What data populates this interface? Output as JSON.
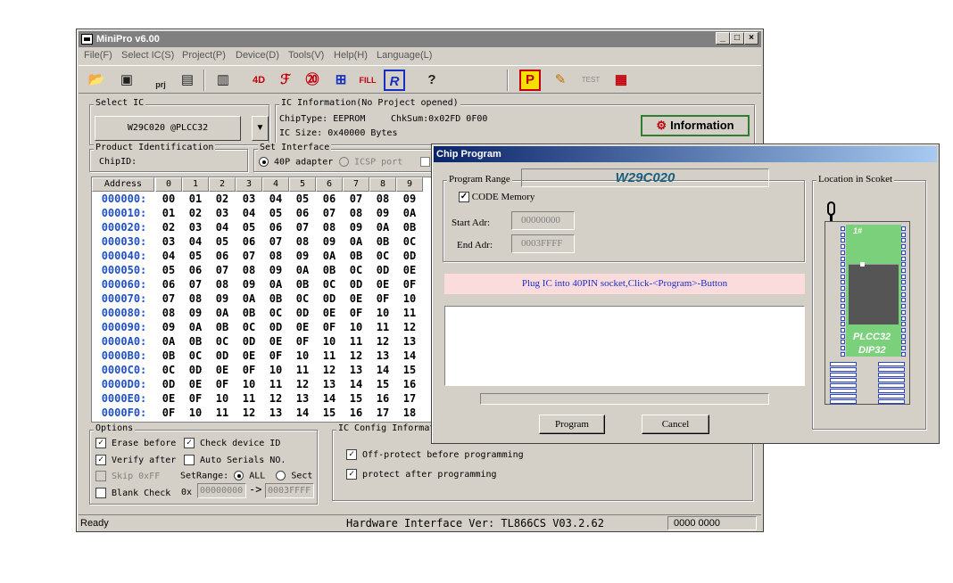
{
  "window": {
    "title": "MiniPro v6.00",
    "min": "_",
    "max": "□",
    "close": "×"
  },
  "menu": [
    "File(F)",
    "Select IC(S)",
    "Project(P)",
    "Device(D)",
    "Tools(V)",
    "Help(H)",
    "Language(L)"
  ],
  "toolbar": {
    "prj_label": "prj",
    "open": "📂",
    "save": "💾",
    "fourd": "4D",
    "fill": "FILL",
    "r": "R",
    "help": "?",
    "p": "P",
    "test": "TEST"
  },
  "select_ic": {
    "legend": "Select IC",
    "value": "W29C020 @PLCC32",
    "arrow": "▼"
  },
  "ic_info": {
    "legend": "IC Information(No Project opened)",
    "chip_type_label": "ChipType:",
    "chip_type": "EEPROM",
    "chksum_label": "ChkSum:",
    "chksum": "0x02FD 0F00",
    "ic_size_label": "IC Size:",
    "ic_size": "0x40000 Bytes",
    "info_button": "Information"
  },
  "product_id": {
    "legend": "Product Identification",
    "chip_id_label": "ChipID:"
  },
  "set_interface": {
    "legend": "Set Interface",
    "opt1": "40P adapter",
    "opt2": "ICSP port"
  },
  "hex": {
    "address_header": "Address",
    "columns": [
      "0",
      "1",
      "2",
      "3",
      "4",
      "5",
      "6",
      "7",
      "8",
      "9"
    ],
    "rows": [
      {
        "addr": "000000:",
        "cells": [
          "00",
          "01",
          "02",
          "03",
          "04",
          "05",
          "06",
          "07",
          "08",
          "09"
        ]
      },
      {
        "addr": "000010:",
        "cells": [
          "01",
          "02",
          "03",
          "04",
          "05",
          "06",
          "07",
          "08",
          "09",
          "0A"
        ]
      },
      {
        "addr": "000020:",
        "cells": [
          "02",
          "03",
          "04",
          "05",
          "06",
          "07",
          "08",
          "09",
          "0A",
          "0B"
        ]
      },
      {
        "addr": "000030:",
        "cells": [
          "03",
          "04",
          "05",
          "06",
          "07",
          "08",
          "09",
          "0A",
          "0B",
          "0C"
        ]
      },
      {
        "addr": "000040:",
        "cells": [
          "04",
          "05",
          "06",
          "07",
          "08",
          "09",
          "0A",
          "0B",
          "0C",
          "0D"
        ]
      },
      {
        "addr": "000050:",
        "cells": [
          "05",
          "06",
          "07",
          "08",
          "09",
          "0A",
          "0B",
          "0C",
          "0D",
          "0E"
        ]
      },
      {
        "addr": "000060:",
        "cells": [
          "06",
          "07",
          "08",
          "09",
          "0A",
          "0B",
          "0C",
          "0D",
          "0E",
          "0F"
        ]
      },
      {
        "addr": "000070:",
        "cells": [
          "07",
          "08",
          "09",
          "0A",
          "0B",
          "0C",
          "0D",
          "0E",
          "0F",
          "10"
        ]
      },
      {
        "addr": "000080:",
        "cells": [
          "08",
          "09",
          "0A",
          "0B",
          "0C",
          "0D",
          "0E",
          "0F",
          "10",
          "11"
        ]
      },
      {
        "addr": "000090:",
        "cells": [
          "09",
          "0A",
          "0B",
          "0C",
          "0D",
          "0E",
          "0F",
          "10",
          "11",
          "12"
        ]
      },
      {
        "addr": "0000A0:",
        "cells": [
          "0A",
          "0B",
          "0C",
          "0D",
          "0E",
          "0F",
          "10",
          "11",
          "12",
          "13"
        ]
      },
      {
        "addr": "0000B0:",
        "cells": [
          "0B",
          "0C",
          "0D",
          "0E",
          "0F",
          "10",
          "11",
          "12",
          "13",
          "14"
        ]
      },
      {
        "addr": "0000C0:",
        "cells": [
          "0C",
          "0D",
          "0E",
          "0F",
          "10",
          "11",
          "12",
          "13",
          "14",
          "15"
        ]
      },
      {
        "addr": "0000D0:",
        "cells": [
          "0D",
          "0E",
          "0F",
          "10",
          "11",
          "12",
          "13",
          "14",
          "15",
          "16"
        ]
      },
      {
        "addr": "0000E0:",
        "cells": [
          "0E",
          "0F",
          "10",
          "11",
          "12",
          "13",
          "14",
          "15",
          "16",
          "17"
        ]
      },
      {
        "addr": "0000F0:",
        "cells": [
          "0F",
          "10",
          "11",
          "12",
          "13",
          "14",
          "15",
          "16",
          "17",
          "18"
        ]
      }
    ]
  },
  "options": {
    "legend": "Options",
    "erase_before": "Erase before",
    "check_device_id": "Check device ID",
    "verify_after": "Verify after",
    "auto_serials": "Auto Serials NO.",
    "skip_0xff": "Skip 0xFF",
    "set_range_label": "SetRange:",
    "all": "ALL",
    "sect": "Sect",
    "blank_check": "Blank Check",
    "ox": "0x",
    "range_start": "00000000",
    "arrow": "->",
    "range_end": "0003FFFF"
  },
  "ic_config": {
    "legend": "IC Config Informat",
    "off_protect": "Off-protect before programming",
    "protect_after": "protect after programming"
  },
  "status": {
    "ready": "Ready",
    "hw": "Hardware Interface Ver: TL866CS V03.2.62",
    "right": "0000 0000"
  },
  "dialog": {
    "title": "Chip Program",
    "program_range": "Program Range",
    "chip_name": "W29C020",
    "code_memory": "CODE Memory",
    "start_label": "Start Adr:",
    "start_value": "00000000",
    "end_label": "End Adr:",
    "end_value": "0003FFFF",
    "message": "Plug IC into 40PIN socket,Click-<Program>-Button",
    "program_button": "Program",
    "cancel_button": "Cancel",
    "location_legend": "Location in Scoket",
    "chip_hash": "1#",
    "pkg1": "PLCC32",
    "pkg2": "DIP32"
  }
}
